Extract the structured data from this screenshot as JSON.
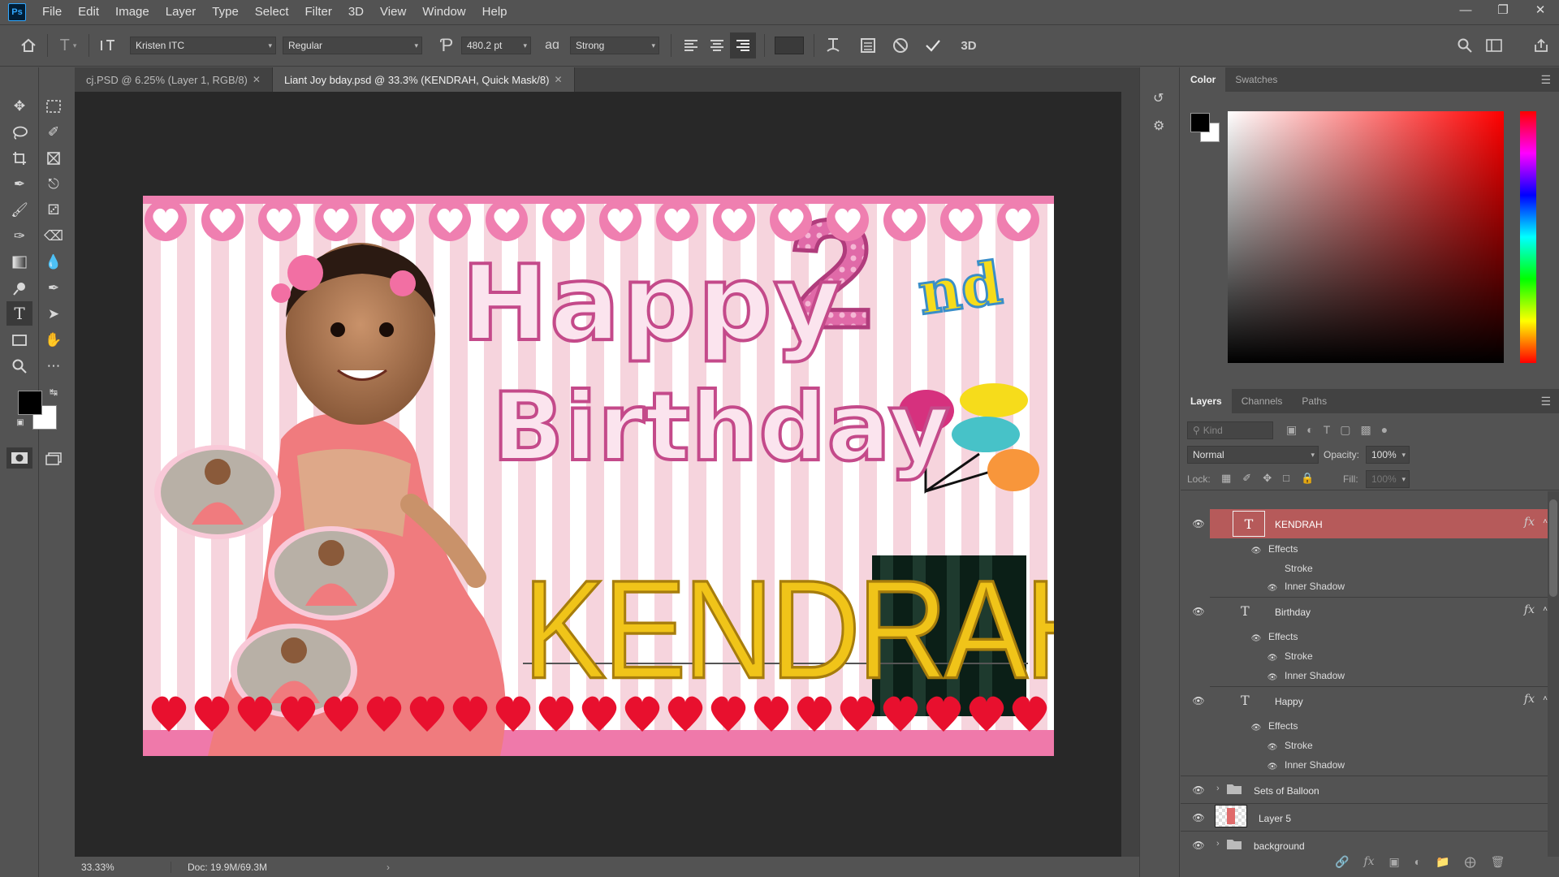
{
  "app": {
    "logo": "Ps"
  },
  "menu": [
    "File",
    "Edit",
    "Image",
    "Layer",
    "Type",
    "Select",
    "Filter",
    "3D",
    "View",
    "Window",
    "Help"
  ],
  "options": {
    "font_family": "Kristen ITC",
    "font_style": "Regular",
    "font_size": "480.2 pt",
    "aa_label": "aɑ",
    "anti_alias": "Strong",
    "three_d": "3D"
  },
  "doc_tabs": [
    {
      "label": "cj.PSD @ 6.25% (Layer 1, RGB/8)",
      "active": false
    },
    {
      "label": "Liant Joy bday.psd @ 33.3% (KENDRAH, Quick Mask/8)",
      "active": true
    }
  ],
  "status": {
    "zoom": "33.33%",
    "doc": "Doc: 19.9M/69.3M"
  },
  "artwork": {
    "word1": "Happy",
    "word2": "Birthday",
    "big_number": "2",
    "ordinal": "nd",
    "name": "KENDRAH"
  },
  "color_panel": {
    "tabs": [
      "Color",
      "Swatches"
    ],
    "foreground": "#000000",
    "background": "#ffffff"
  },
  "layers_panel": {
    "tabs": [
      "Layers",
      "Channels",
      "Paths"
    ],
    "filter_placeholder": "Kind",
    "blend_mode": "Normal",
    "opacity_label": "Opacity:",
    "opacity": "100%",
    "lock_label": "Lock:",
    "fill_label": "Fill:",
    "fill": "100%",
    "layers": [
      {
        "name": "KENDRAH",
        "type": "text",
        "selected": true,
        "effects_label": "Effects",
        "effects": [
          "Stroke",
          "Inner Shadow"
        ]
      },
      {
        "name": "Birthday",
        "type": "text",
        "selected": false,
        "effects_label": "Effects",
        "effects": [
          "Stroke",
          "Inner Shadow"
        ]
      },
      {
        "name": "Happy",
        "type": "text",
        "selected": false,
        "effects_label": "Effects",
        "effects": [
          "Stroke",
          "Inner Shadow"
        ]
      },
      {
        "name": "Sets of Balloon",
        "type": "group"
      },
      {
        "name": "Layer 5",
        "type": "pixel"
      },
      {
        "name": "background",
        "type": "group"
      }
    ]
  },
  "colors": {
    "selected_layer": "#b65a5a",
    "panel_bg": "#535353",
    "canvas_bg": "#282828"
  }
}
